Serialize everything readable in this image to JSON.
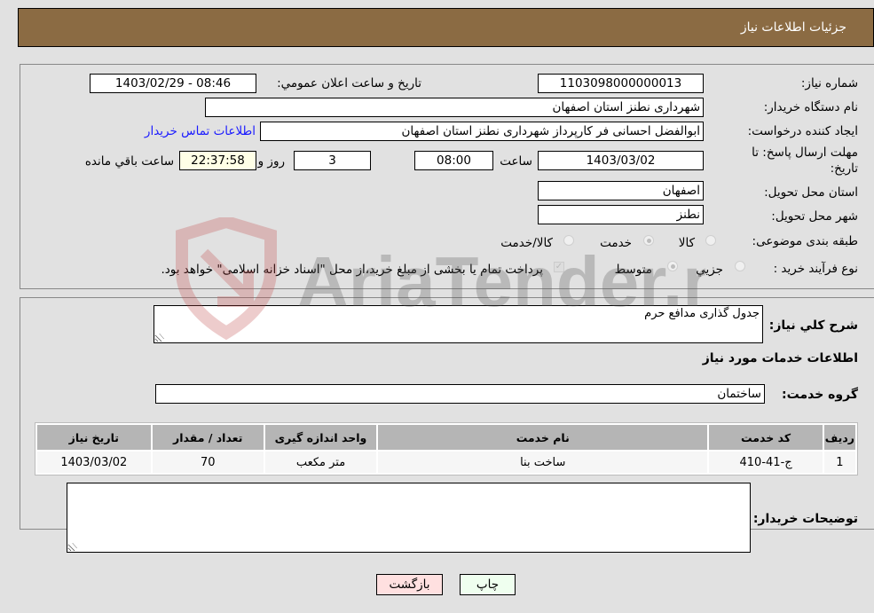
{
  "header": {
    "title": "جزئیات اطلاعات نیاز"
  },
  "form": {
    "need_number": {
      "label": "شماره نیاز:",
      "value": "1103098000000013"
    },
    "announce": {
      "label": "تاریخ و ساعت اعلان عمومي:",
      "value": "1403/02/29 - 08:46"
    },
    "buyer_org": {
      "label": "نام دستگاه خريدار:",
      "value": "شهرداری نطنز استان اصفهان"
    },
    "requester": {
      "label": "ایجاد کننده درخواست:",
      "value": "ابوالفضل احسانی فر کارپرداز شهرداری نطنز استان اصفهان",
      "contact_link": "اطلاعات تماس خریدار"
    },
    "deadline": {
      "label_line1": "مهلت ارسال پاسخ: تا",
      "label_line2": "تاریخ:",
      "date": "1403/03/02",
      "time_label": "ساعت",
      "time": "08:00",
      "days": "3",
      "days_label": "روز و",
      "remaining": "22:37:58",
      "remaining_label": "ساعت باقي مانده"
    },
    "province": {
      "label": "استان محل تحویل:",
      "value": "اصفهان"
    },
    "city": {
      "label": "شهر محل تحویل:",
      "value": "نطنز"
    },
    "category": {
      "label": "طبقه بندی موضوعی:",
      "options": [
        "کالا",
        "خدمت",
        "کالا/خدمت"
      ],
      "selected": "خدمت"
    },
    "process": {
      "label": "نوع فرآیند خرید :",
      "options": [
        "جزيي",
        "متوسط"
      ],
      "selected": "متوسط",
      "checkbox_text": "پرداخت تمام یا بخشی از مبلغ خرید،از محل \"اسناد خزانه اسلامی\" خواهد بود.",
      "checkbox_checked": true
    }
  },
  "details": {
    "description_label": "شرح کلي نياز:",
    "description": "جدول گذاری مدافع حرم",
    "services_heading": "اطلاعات خدمات مورد نياز",
    "service_group_label": "گروه خدمت:",
    "service_group": "ساختمان",
    "table": {
      "headers": [
        "رديف",
        "کد خدمت",
        "نام خدمت",
        "واحد اندازه گیری",
        "تعداد / مقدار",
        "تاریخ نیاز"
      ],
      "rows": [
        [
          "1",
          "ج-41-410",
          "ساخت بنا",
          "متر مکعب",
          "70",
          "1403/03/02"
        ]
      ]
    },
    "buyer_notes_label": "توضيحات خريدار:",
    "buyer_notes": ""
  },
  "buttons": {
    "print": "چاپ",
    "back": "بازگشت"
  },
  "watermark": {
    "text": "AriaTender.neT"
  },
  "colors": {
    "header": "#8b6b43",
    "print_bg": "#efffef",
    "back_bg": "#ffe0e0",
    "link": "#1a1aff"
  }
}
